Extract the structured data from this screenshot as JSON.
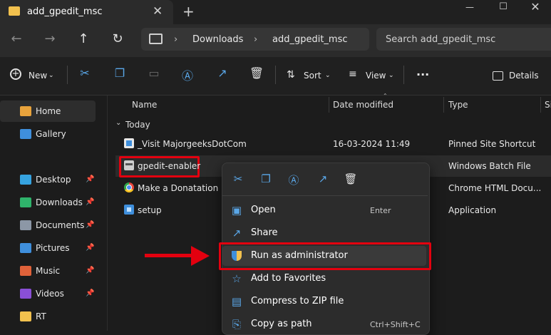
{
  "window": {
    "tab_title": "add_gpedit_msc",
    "close_tab": "✕",
    "new_tab": "+",
    "minimize": "—",
    "maximize": "☐",
    "close": "✕"
  },
  "address": {
    "back": "←",
    "forward": "→",
    "up": "↑",
    "refresh": "↻",
    "crumbs": [
      "Downloads",
      "add_gpedit_msc"
    ],
    "search_placeholder": "Search add_gpedit_msc"
  },
  "toolbar": {
    "new_label": "New",
    "sort_label": "Sort",
    "view_label": "View",
    "more_label": "···",
    "details_label": "Details"
  },
  "sidebar": {
    "items": [
      {
        "label": "Home",
        "icon": "home-icon",
        "color": "#e8a33c",
        "pinned": false,
        "selected": true
      },
      {
        "label": "Gallery",
        "icon": "gallery-icon",
        "color": "#3f8fdc",
        "pinned": false
      },
      {
        "label": "Desktop",
        "icon": "desktop-icon",
        "color": "#36a3e0",
        "pinned": true
      },
      {
        "label": "Downloads",
        "icon": "download-icon",
        "color": "#2fb36b",
        "pinned": true
      },
      {
        "label": "Documents",
        "icon": "documents-icon",
        "color": "#8c97a6",
        "pinned": true
      },
      {
        "label": "Pictures",
        "icon": "pictures-icon",
        "color": "#3f8fdc",
        "pinned": true
      },
      {
        "label": "Music",
        "icon": "music-icon",
        "color": "#e0623a",
        "pinned": true
      },
      {
        "label": "Videos",
        "icon": "videos-icon",
        "color": "#8a4fd6",
        "pinned": true
      },
      {
        "label": "RT",
        "icon": "folder-icon",
        "color": "#f2c14e",
        "pinned": false
      }
    ]
  },
  "columns": {
    "name": "Name",
    "date": "Date modified",
    "type": "Type",
    "size": "Si"
  },
  "group_label": "Today",
  "files": [
    {
      "name": "_Visit MajorgeeksDotCom",
      "date": "16-03-2024 11:49",
      "type": "Pinned Site Shortcut",
      "icon": "shortcut-icon"
    },
    {
      "name": "gpedit-enabler",
      "date": "",
      "type": "Windows Batch File",
      "icon": "batch-file-icon"
    },
    {
      "name": "Make a Donatation",
      "date": "",
      "type": "Chrome HTML Docu...",
      "icon": "chrome-icon"
    },
    {
      "name": "setup",
      "date": "",
      "type": "Application",
      "icon": "setup-icon"
    }
  ],
  "context_menu": {
    "quick_actions": [
      "cut-icon",
      "copy-icon",
      "rename-icon",
      "share-icon",
      "delete-icon"
    ],
    "items": [
      {
        "label": "Open",
        "shortcut": "Enter",
        "icon": "open-icon"
      },
      {
        "label": "Share",
        "shortcut": "",
        "icon": "share-icon"
      },
      {
        "label": "Run as administrator",
        "shortcut": "",
        "icon": "shield-icon"
      },
      {
        "label": "Add to Favorites",
        "shortcut": "",
        "icon": "star-icon"
      },
      {
        "label": "Compress to ZIP file",
        "shortcut": "",
        "icon": "zip-icon"
      },
      {
        "label": "Copy as path",
        "shortcut": "Ctrl+Shift+C",
        "icon": "path-icon"
      }
    ]
  },
  "colors": {
    "accent": "#5aa7e8",
    "highlight_red": "#e3000f"
  }
}
